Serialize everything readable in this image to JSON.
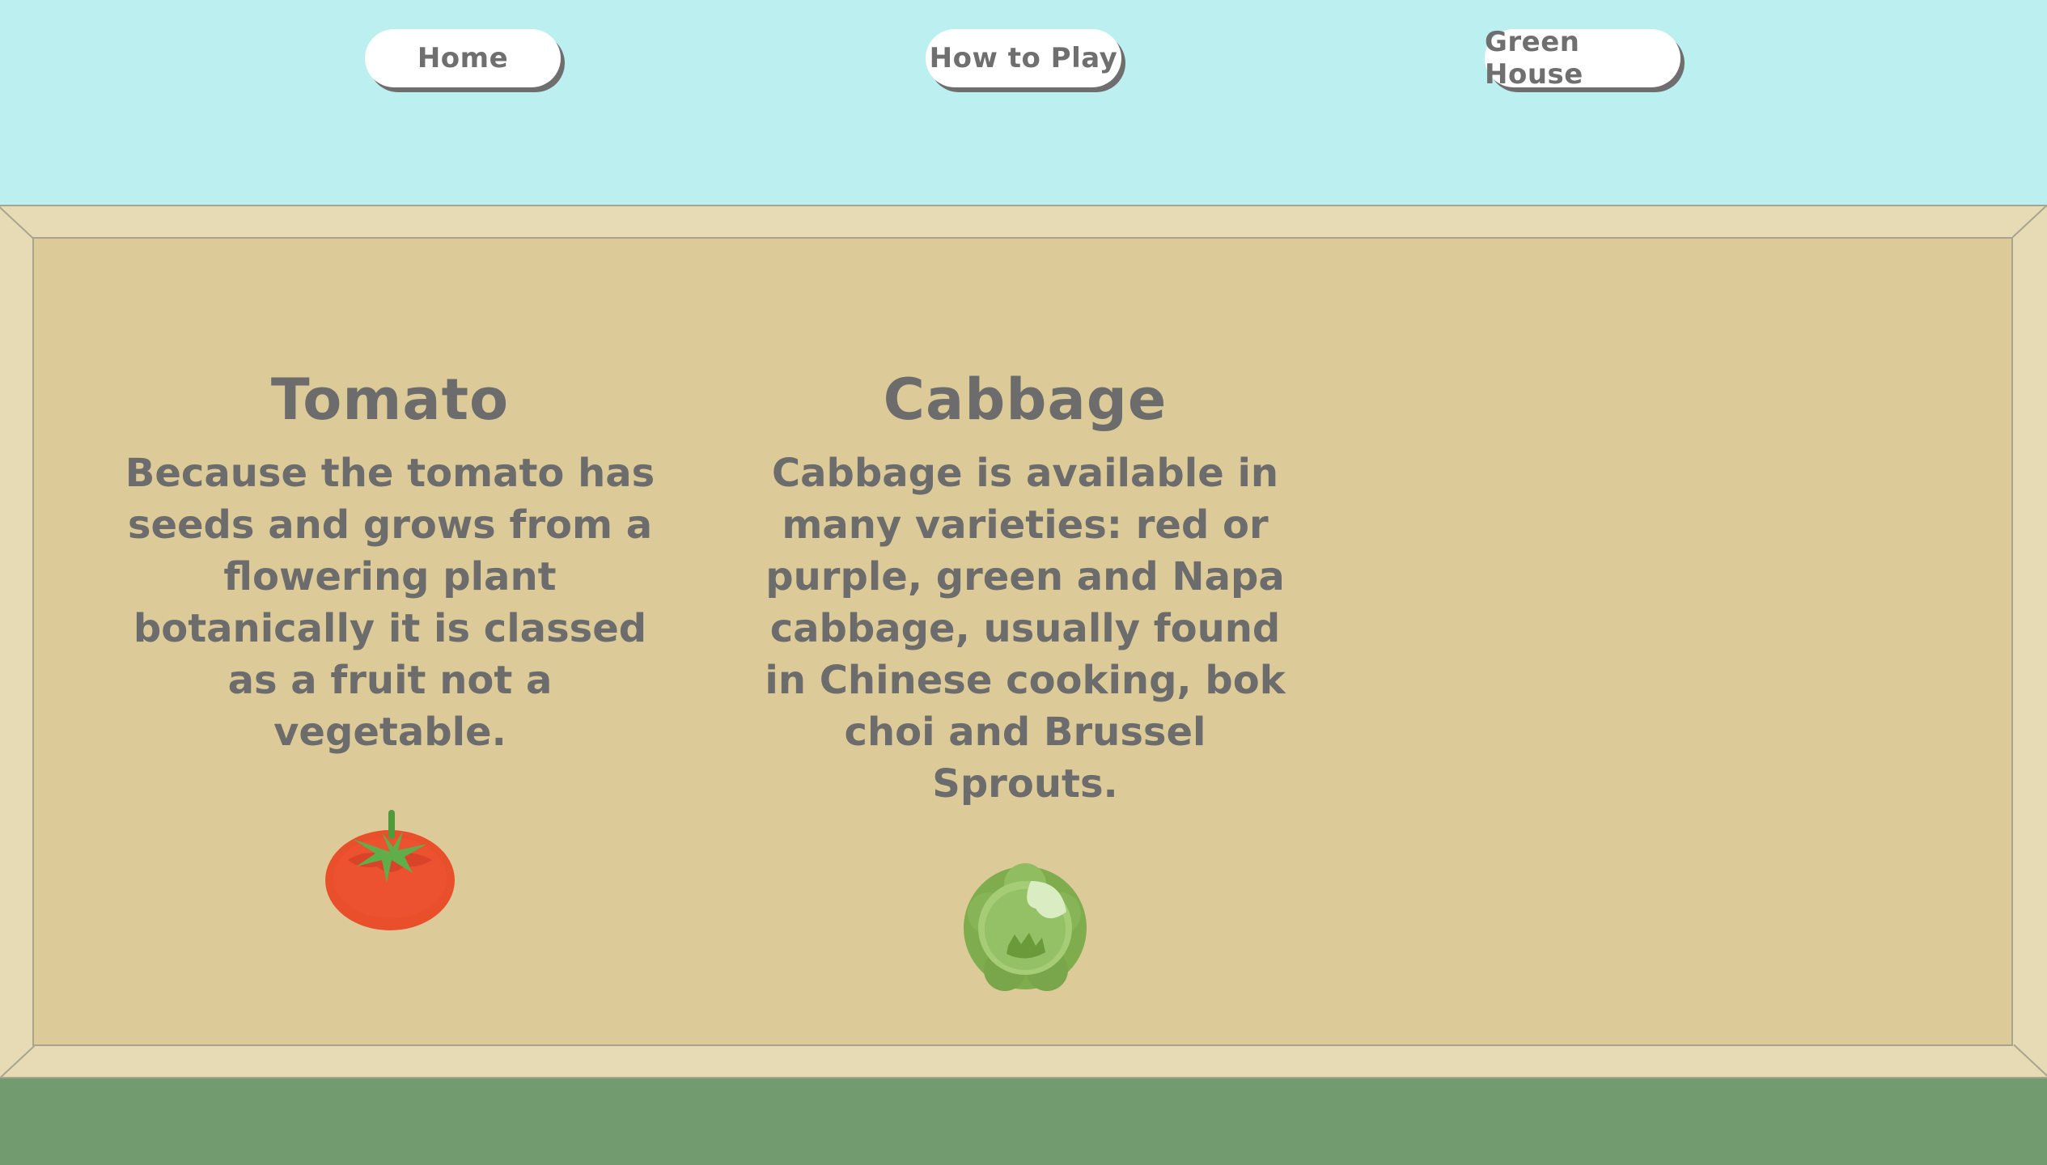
{
  "nav": {
    "home": "Home",
    "how_to_play": "How to Play",
    "green_house": "Green House"
  },
  "cards": [
    {
      "title": "Tomato",
      "description": "Because the tomato has seeds and grows from a flowering plant botanically it is classed as a fruit not a vegetable.",
      "icon": "tomato-icon"
    },
    {
      "title": "Cabbage",
      "description": "Cabbage is available in many varieties: red or purple, green and Napa cabbage, usually found in Chinese cooking, bok choi and Brussel Sprouts.",
      "icon": "cabbage-icon"
    }
  ],
  "colors": {
    "sky": "#bcefef",
    "frame": "#e6dbb5",
    "board": "#dccb99",
    "grass": "#729b6f",
    "text": "#6c6c6c"
  }
}
